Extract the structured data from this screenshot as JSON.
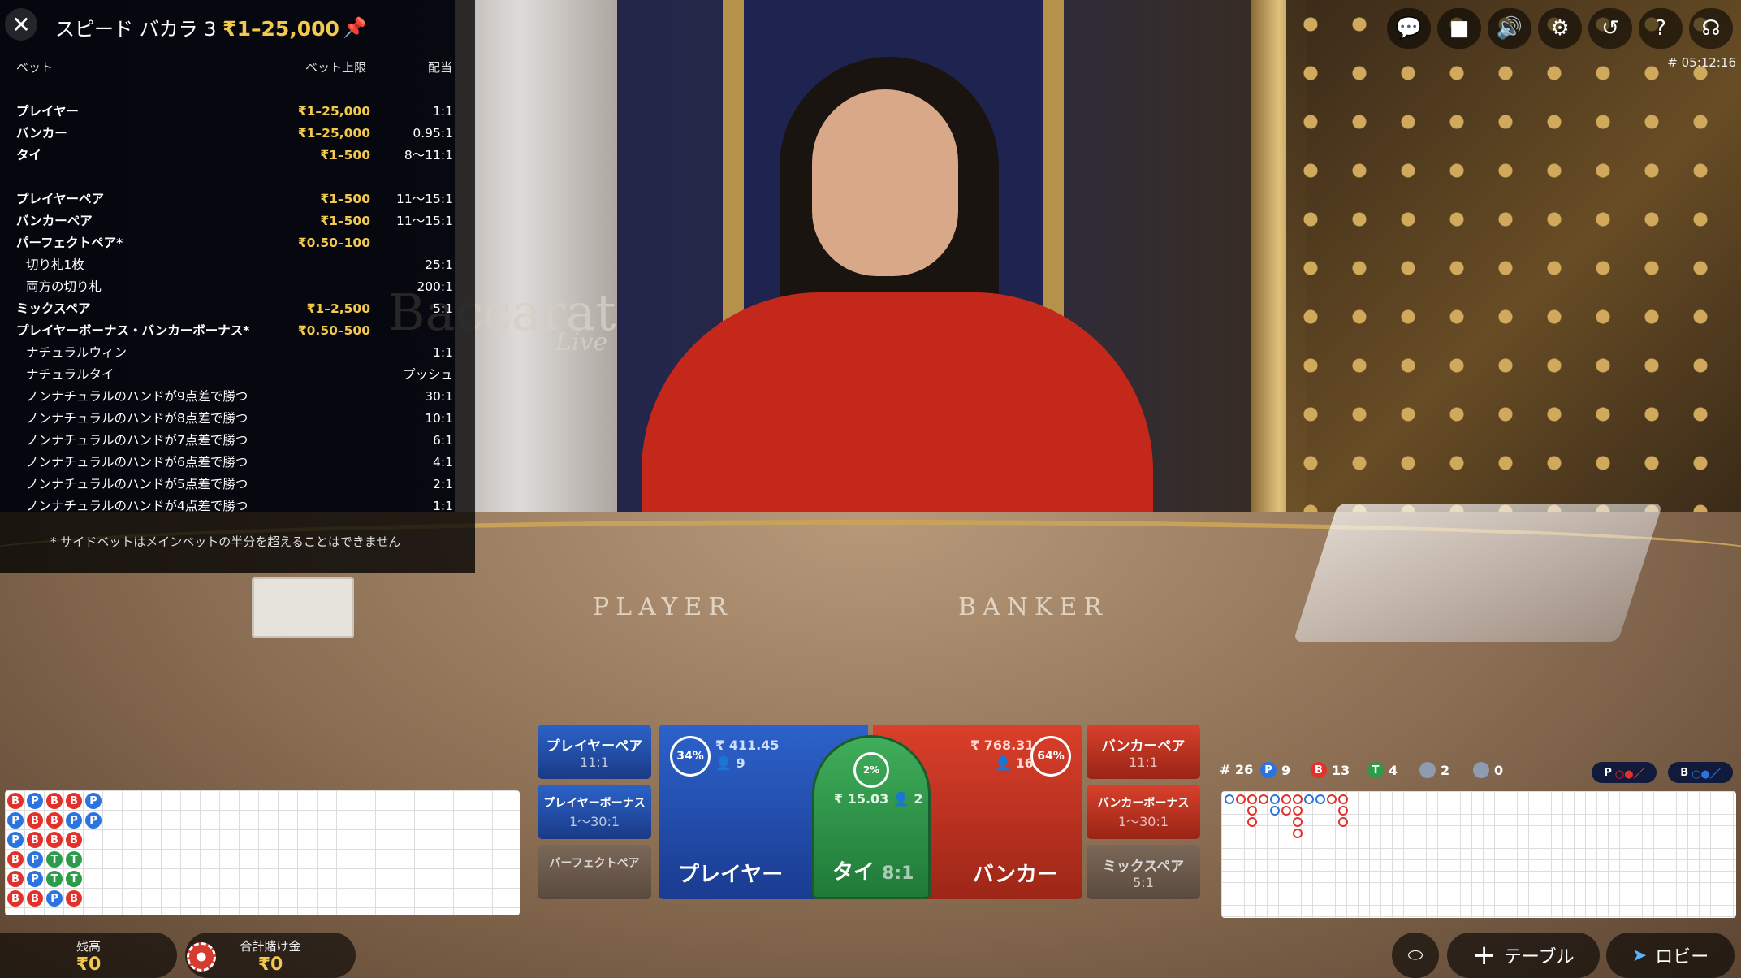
{
  "header": {
    "title": "スピード バカラ 3",
    "limit": "₹1–25,000"
  },
  "limits_table": {
    "col_bet": "ベット",
    "col_limit": "ベット上限",
    "col_payout": "配当",
    "rows": [
      {
        "name": "プレイヤー",
        "limit": "₹1–25,000",
        "payout": "1:1",
        "type": "main"
      },
      {
        "name": "バンカー",
        "limit": "₹1–25,000",
        "payout": "0.95:1",
        "type": "main"
      },
      {
        "name": "タイ",
        "limit": "₹1–500",
        "payout": "8～11:1",
        "type": "main"
      },
      {
        "name": "",
        "limit": "",
        "payout": "",
        "type": "gap"
      },
      {
        "name": "プレイヤーペア",
        "limit": "₹1–500",
        "payout": "11～15:1",
        "type": "main"
      },
      {
        "name": "バンカーペア",
        "limit": "₹1–500",
        "payout": "11～15:1",
        "type": "main"
      },
      {
        "name": "パーフェクトペア*",
        "limit": "₹0.50–100",
        "payout": "",
        "type": "main"
      },
      {
        "name": "切り札1枚",
        "limit": "",
        "payout": "25:1",
        "type": "sub"
      },
      {
        "name": "両方の切り札",
        "limit": "",
        "payout": "200:1",
        "type": "sub"
      },
      {
        "name": "ミックスペア",
        "limit": "₹1–2,500",
        "payout": "5:1",
        "type": "main"
      },
      {
        "name": "プレイヤーボーナス・バンカーボーナス*",
        "limit": "₹0.50–500",
        "payout": "",
        "type": "main"
      },
      {
        "name": "ナチュラルウィン",
        "limit": "",
        "payout": "1:1",
        "type": "sub"
      },
      {
        "name": "ナチュラルタイ",
        "limit": "",
        "payout": "プッシュ",
        "type": "sub"
      },
      {
        "name": "ノンナチュラルのハンドが9点差で勝つ",
        "limit": "",
        "payout": "30:1",
        "type": "sub"
      },
      {
        "name": "ノンナチュラルのハンドが8点差で勝つ",
        "limit": "",
        "payout": "10:1",
        "type": "sub"
      },
      {
        "name": "ノンナチュラルのハンドが7点差で勝つ",
        "limit": "",
        "payout": "6:1",
        "type": "sub"
      },
      {
        "name": "ノンナチュラルのハンドが6点差で勝つ",
        "limit": "",
        "payout": "4:1",
        "type": "sub"
      },
      {
        "name": "ノンナチュラルのハンドが5点差で勝つ",
        "limit": "",
        "payout": "2:1",
        "type": "sub"
      },
      {
        "name": "ノンナチュラルのハンドが4点差で勝つ",
        "limit": "",
        "payout": "1:1",
        "type": "sub"
      }
    ],
    "footnote": "* サイドベットはメインベットの半分を超えることはできません"
  },
  "top_icons": [
    "chat-icon",
    "video-icon",
    "sound-icon",
    "settings-icon",
    "history-icon",
    "help-icon",
    "headset-icon"
  ],
  "game_id": "# 05:12:16",
  "scene": {
    "logo": "Baccarat",
    "logo_sub": "Live",
    "table_player": "PLAYER",
    "table_banker": "BANKER"
  },
  "bets": {
    "player_pair": {
      "label": "プレイヤーペア",
      "odds": "11:1"
    },
    "player_bonus": {
      "label": "プレイヤーボーナス",
      "odds": "1～30:1"
    },
    "perfect_pair": {
      "label": "パーフェクトペア"
    },
    "banker_pair": {
      "label": "バンカーペア",
      "odds": "11:1"
    },
    "banker_bonus": {
      "label": "バンカーボーナス",
      "odds": "1～30:1"
    },
    "mixed_pair": {
      "label": "ミックスペア",
      "odds": "5:1"
    },
    "player": {
      "label": "プレイヤー",
      "pct": "34%",
      "amount": "₹ 411.45",
      "players": "9"
    },
    "banker": {
      "label": "バンカー",
      "pct": "64%",
      "amount": "₹ 768.31",
      "players": "16"
    },
    "tie": {
      "label": "タイ",
      "odds": "8:1",
      "pct": "2%",
      "amount": "₹ 15.03",
      "players": "2"
    }
  },
  "road_stats": {
    "round": "# 26",
    "p_label": "P",
    "p_count": "9",
    "b_label": "B",
    "b_count": "13",
    "t_label": "T",
    "t_count": "4",
    "player_pair_count": "2",
    "banker_pair_count": "0",
    "predict_p": "P",
    "predict_b": "B"
  },
  "bead_road": [
    [
      "B",
      "P",
      "B",
      "B",
      "P"
    ],
    [
      "P",
      "B",
      "B",
      "P",
      "P"
    ],
    [
      "P",
      "B",
      "B",
      "B"
    ],
    [
      "B",
      "P",
      "T",
      "T"
    ],
    [
      "B",
      "P",
      "T",
      "T"
    ],
    [
      "B",
      "B",
      "P",
      "B"
    ]
  ],
  "colors": {
    "player": "#2b74e0",
    "banker": "#e2312b",
    "tie": "#2c9b4a",
    "accent": "#f2c94c"
  },
  "bottom": {
    "balance_label": "残高",
    "balance_value": "₹0",
    "total_bet_label": "合計賭け金",
    "total_bet_value": "₹0",
    "table_label": "テーブル",
    "lobby_label": "ロビー"
  }
}
